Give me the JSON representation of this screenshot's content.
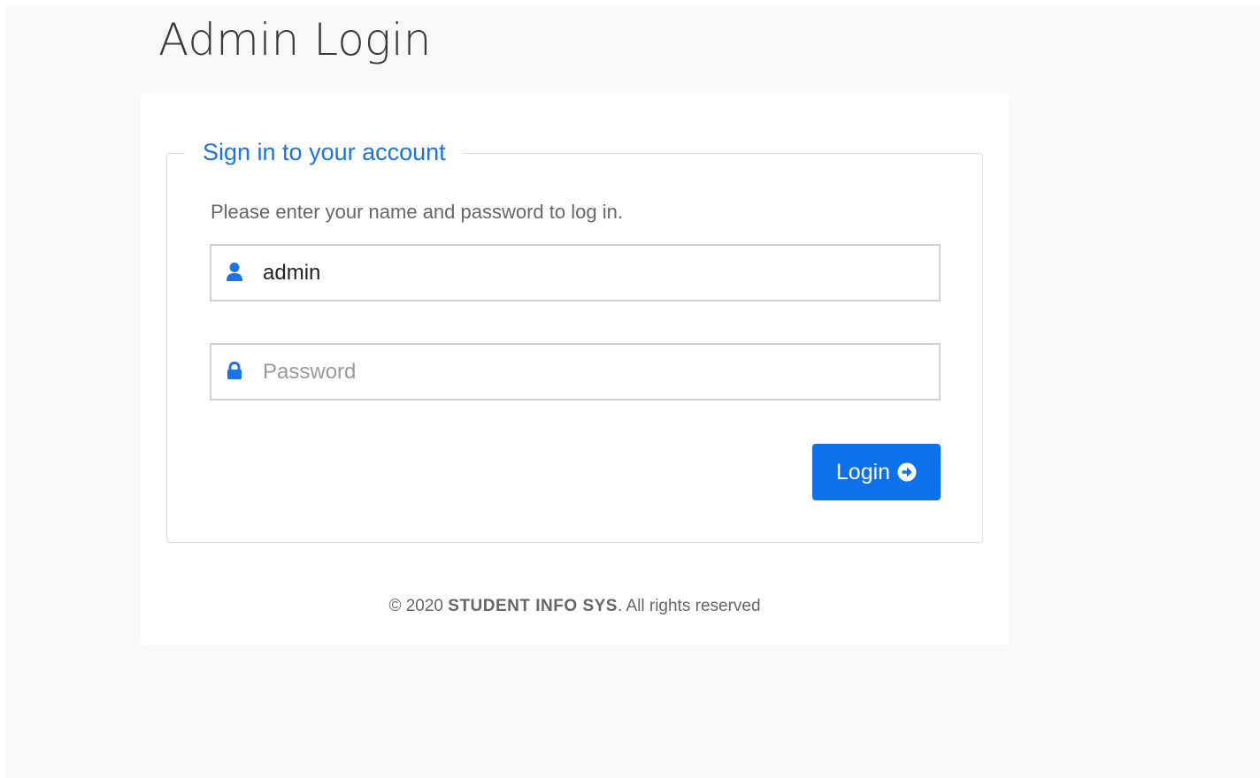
{
  "page": {
    "title": "Admin Login"
  },
  "login_form": {
    "legend": "Sign in to your account",
    "instructions": "Please enter your name and password to log in.",
    "username": {
      "value": "admin",
      "icon": "user-icon"
    },
    "password": {
      "value": "",
      "placeholder": "Password",
      "icon": "lock-icon"
    },
    "submit_label": "Login",
    "submit_icon": "arrow-circle-right-icon"
  },
  "footer": {
    "copyright": "© 2020",
    "brand": "STUDENT INFO SYS",
    "rights": ". All rights reserved"
  },
  "colors": {
    "accent": "#0d72ea",
    "legend_text": "#1a73e8",
    "page_background": "#f8f8f8",
    "card_background": "#ffffff",
    "muted_text": "#666666"
  }
}
